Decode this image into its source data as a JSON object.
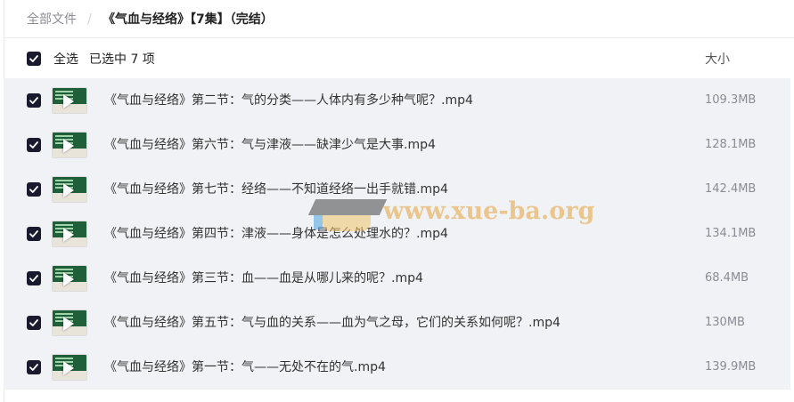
{
  "breadcrumb": {
    "root": "全部文件",
    "separator": "/",
    "current": "《气血与经络》【7集】（完结）"
  },
  "header": {
    "select_all_label": "全选",
    "selected_count_label": "已选中 7 项",
    "size_column_label": "大小"
  },
  "files": [
    {
      "name": "《气血与经络》第二节：气的分类——人体内有多少种气呢？.mp4",
      "size": "109.3MB",
      "checked": true
    },
    {
      "name": "《气血与经络》第六节：气与津液——缺津少气是大事.mp4",
      "size": "128.1MB",
      "checked": true
    },
    {
      "name": "《气血与经络》第七节：经络——不知道经络一出手就错.mp4",
      "size": "142.4MB",
      "checked": true
    },
    {
      "name": "《气血与经络》第四节：津液——身体是怎么处理水的？.mp4",
      "size": "134.1MB",
      "checked": true
    },
    {
      "name": "《气血与经络》第三节：血——血是从哪儿来的呢？.mp4",
      "size": "68.4MB",
      "checked": true
    },
    {
      "name": "《气血与经络》第五节：气与血的关系——血为气之母，它们的关系如何呢？.mp4",
      "size": "130MB",
      "checked": true
    },
    {
      "name": "《气血与经络》第一节：气——无处不在的气.mp4",
      "size": "139.9MB",
      "checked": true
    }
  ],
  "watermark": {
    "text": "www.xue-ba.org"
  },
  "icons": {
    "checkbox": "checkbox-checked-icon",
    "thumbnail": "video-thumbnail",
    "play": "play-icon"
  },
  "colors": {
    "checkbox": "#1a1a2e",
    "list_bg": "#f1f2f5",
    "watermark": "#e6a33b"
  }
}
